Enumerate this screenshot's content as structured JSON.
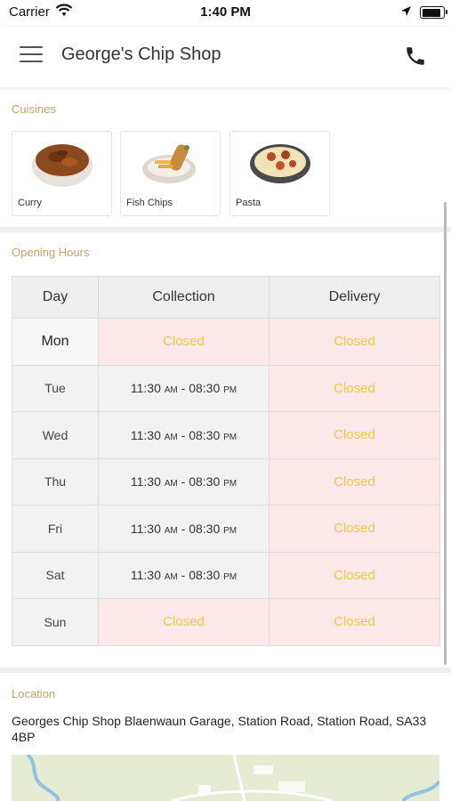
{
  "status_bar": {
    "carrier": "Carrier",
    "time": "1:40 PM"
  },
  "header": {
    "title": "George's Chip Shop"
  },
  "cuisines": {
    "title": "Cuisines",
    "items": [
      {
        "label": "Curry",
        "icon": "curry-bowl"
      },
      {
        "label": "Fish  Chips",
        "icon": "fish-chips-plate"
      },
      {
        "label": "Pasta",
        "icon": "pasta-bowl"
      }
    ]
  },
  "opening_hours": {
    "title": "Opening Hours",
    "columns": [
      "Day",
      "Collection",
      "Delivery"
    ],
    "rows": [
      {
        "day": "Mon",
        "collection": "Closed",
        "delivery": "Closed"
      },
      {
        "day": "Tue",
        "collection": "11:30 AM - 08:30 PM",
        "delivery": "Closed"
      },
      {
        "day": "Wed",
        "collection": "11:30 AM - 08:30 PM",
        "delivery": "Closed"
      },
      {
        "day": "Thu",
        "collection": "11:30 AM - 08:30 PM",
        "delivery": "Closed"
      },
      {
        "day": "Fri",
        "collection": "11:30 AM - 08:30 PM",
        "delivery": "Closed"
      },
      {
        "day": "Sat",
        "collection": "11:30 AM - 08:30 PM",
        "delivery": "Closed"
      },
      {
        "day": "Sun",
        "collection": "Closed",
        "delivery": "Closed"
      }
    ]
  },
  "location": {
    "title": "Location",
    "address": "Georges Chip Shop Blaenwaun Garage, Station Road, Station Road, SA33 4BP"
  },
  "colors": {
    "accent_gold": "#c2a56a",
    "closed_text": "#f5c842",
    "closed_bg": "#fde9e9"
  }
}
